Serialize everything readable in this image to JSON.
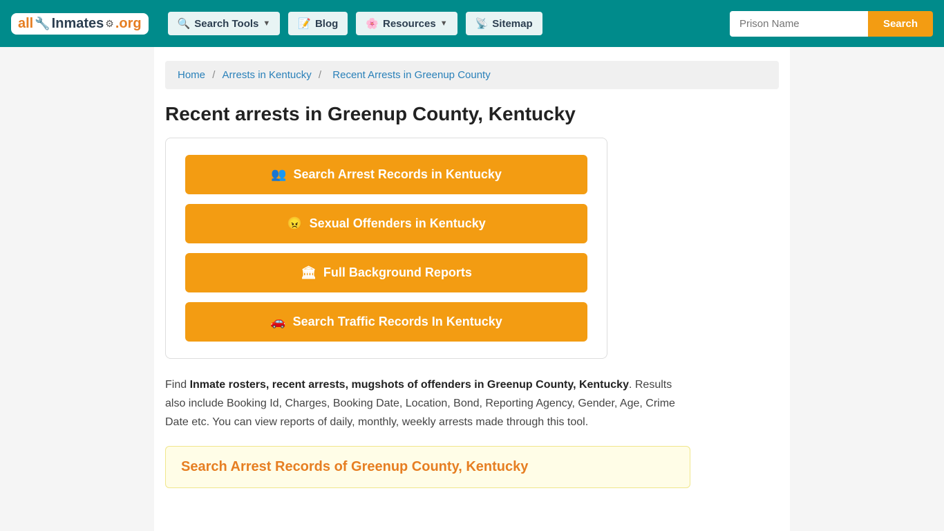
{
  "navbar": {
    "logo": {
      "all": "all",
      "inmates": "Inmates",
      "org": ".org"
    },
    "nav_items": [
      {
        "label": "Search Tools",
        "has_arrow": true,
        "icon": "🔍"
      },
      {
        "label": "Blog",
        "has_arrow": false,
        "icon": "📝"
      },
      {
        "label": "Resources",
        "has_arrow": true,
        "icon": "🌸"
      },
      {
        "label": "Sitemap",
        "has_arrow": false,
        "icon": "📡"
      }
    ],
    "search_placeholder": "Prison Name",
    "search_btn": "Search"
  },
  "breadcrumb": {
    "home": "Home",
    "arrests_ky": "Arrests in Kentucky",
    "current": "Recent Arrests in Greenup County"
  },
  "page": {
    "title": "Recent arrests in Greenup County, Kentucky",
    "buttons": [
      {
        "label": "Search Arrest Records in Kentucky",
        "icon": "people"
      },
      {
        "label": "Sexual Offenders in Kentucky",
        "icon": "angry"
      },
      {
        "label": "Full Background Reports",
        "icon": "building"
      },
      {
        "label": "Search Traffic Records In Kentucky",
        "icon": "car"
      }
    ],
    "description_part1": "Find ",
    "description_bold": "Inmate rosters, recent arrests, mugshots of offenders in Greenup County, Kentucky",
    "description_part2": ". Results also include Booking Id, Charges, Booking Date, Location, Bond, Reporting Agency, Gender, Age, Crime Date etc. You can view reports of daily, monthly, weekly arrests made through this tool.",
    "bottom_title": "Search Arrest Records of Greenup County, Kentucky"
  }
}
